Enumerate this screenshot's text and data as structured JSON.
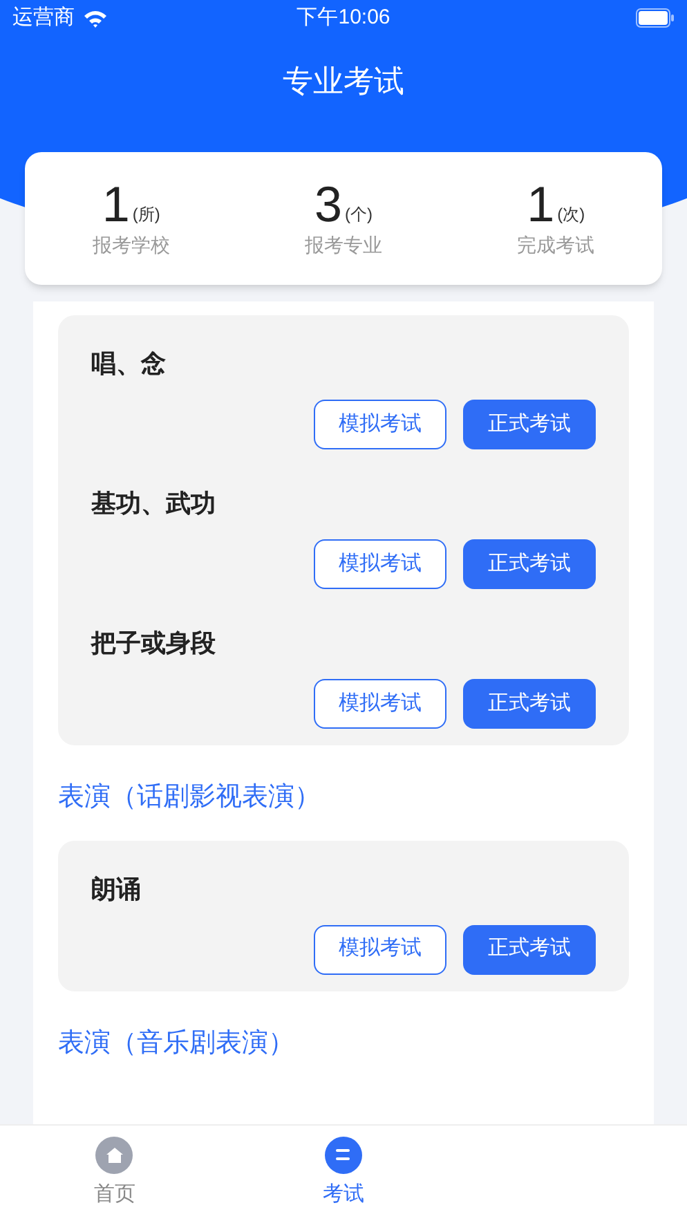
{
  "status_bar": {
    "carrier": "运营商",
    "time": "下午10:06"
  },
  "title": "专业考试",
  "stats": [
    {
      "value": "1",
      "unit": "(所)",
      "label": "报考学校"
    },
    {
      "value": "3",
      "unit": "(个)",
      "label": "报考专业"
    },
    {
      "value": "1",
      "unit": "(次)",
      "label": "完成考试"
    }
  ],
  "sections": [
    {
      "items": [
        {
          "name": "唱、念",
          "buttons": [
            "模拟考试",
            "正式考试"
          ]
        },
        {
          "name": "基功、武功",
          "buttons": [
            "模拟考试",
            "正式考试"
          ]
        },
        {
          "name": "把子或身段",
          "buttons": [
            "模拟考试",
            "正式考试"
          ]
        }
      ]
    },
    {
      "heading": "表演（话剧影视表演）",
      "items": [
        {
          "name": "朗诵",
          "buttons": [
            "模拟考试",
            "正式考试"
          ]
        }
      ]
    },
    {
      "heading": "表演（音乐剧表演）"
    }
  ],
  "tab_bar": [
    {
      "label": "首页",
      "kind": "home",
      "selected": false
    },
    {
      "label": "考试",
      "kind": "exam",
      "selected": true
    }
  ]
}
